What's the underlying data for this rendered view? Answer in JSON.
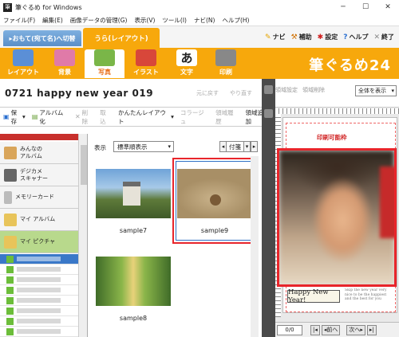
{
  "window": {
    "title": "筆ぐるめ for Windows",
    "controls": {
      "minimize": "─",
      "maximize": "☐",
      "close": "✕"
    }
  },
  "menu": [
    "ファイル(F)",
    "編集(E)",
    "画像データの管理(G)",
    "表示(V)",
    "ツール(I)",
    "ナビ(N)",
    "ヘルプ(H)"
  ],
  "mode_tabs": {
    "omote": "▸おもて(宛て名)へ切替",
    "ura": "うら(レイアウト)"
  },
  "top_right": {
    "navi": "ナビ",
    "hojo": "補助",
    "settei": "設定",
    "help": "ヘルプ",
    "exit": "終了"
  },
  "tools": [
    {
      "label": "レイアウト",
      "icon": "layout-icon",
      "color": "#5b8fd6",
      "glyph": ""
    },
    {
      "label": "背景",
      "icon": "background-icon",
      "color": "#e07aa8",
      "glyph": ""
    },
    {
      "label": "写真",
      "icon": "photo-icon",
      "color": "#7ab648",
      "glyph": ""
    },
    {
      "label": "イラスト",
      "icon": "illustration-icon",
      "color": "#d8473a",
      "glyph": ""
    },
    {
      "label": "文字",
      "icon": "text-icon",
      "color": "#ffffff",
      "glyph": "あ"
    },
    {
      "label": "印刷",
      "icon": "print-icon",
      "color": "#888888",
      "glyph": ""
    }
  ],
  "brand": "筆ぐるめ24",
  "document": {
    "title": "0721 happy new year 019",
    "undo": "元に戻す",
    "redo": "やり直す"
  },
  "toolbar": {
    "save": "保存",
    "album": "アルバム化",
    "delete": "削除",
    "import": "取込",
    "easy_layout": "かんたんレイアウト",
    "collage": "コラージュ",
    "history": "領域履歴",
    "add_area": "領域追加"
  },
  "left_panel": {
    "items": [
      {
        "label": "みんなの\nアルバム"
      },
      {
        "label": "デジカメ\nスキャナー"
      },
      {
        "label": "メモリーカード"
      },
      {
        "label": "マイ アルバム"
      },
      {
        "label": "マイ ピクチャ"
      }
    ]
  },
  "middle_panel": {
    "display_label": "表示",
    "sort_value": "標準順表示",
    "nav_label": "付箋",
    "thumbnails": [
      {
        "caption": "sample7"
      },
      {
        "caption": "sample9"
      },
      {
        "caption": "sample8"
      }
    ]
  },
  "right_panel": {
    "toolbar": [
      "領域設定",
      "領域削除"
    ],
    "view_select": "全体を表示",
    "printable_label": "印刷可能枠",
    "card_text": "Happy New Year!",
    "greeting": "Skip the new year very nice to be the happiest and the best for you",
    "page": "0/0",
    "prev": "前へ",
    "next": "次へ"
  },
  "colors": {
    "accent_orange": "#f7a80c",
    "selection_red": "#e8252b",
    "selection_blue": "#2f6fc4"
  }
}
